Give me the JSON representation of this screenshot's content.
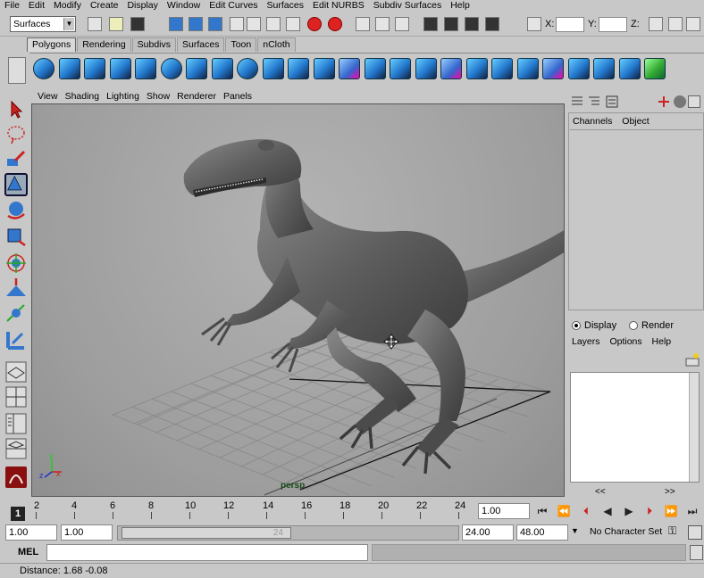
{
  "menubar": [
    "File",
    "Edit",
    "Modify",
    "Create",
    "Display",
    "Window",
    "Edit Curves",
    "Surfaces",
    "Edit NURBS",
    "Subdiv Surfaces",
    "Help"
  ],
  "status": {
    "mode": "Surfaces",
    "x_label": "X:",
    "y_label": "Y:",
    "z_label": "Z:"
  },
  "shelf": {
    "tabs": [
      "Polygons",
      "Rendering",
      "Subdivs",
      "Surfaces",
      "Toon",
      "nCloth"
    ],
    "active": "Polygons"
  },
  "viewport": {
    "menu": [
      "View",
      "Shading",
      "Lighting",
      "Show",
      "Renderer",
      "Panels"
    ],
    "camera": "persp",
    "axis_y": "y",
    "axis_z": "z",
    "axis_x": "x"
  },
  "channel_box": {
    "menu": [
      "Channels",
      "Object"
    ]
  },
  "layer_editor": {
    "display_label": "Display",
    "render_label": "Render",
    "menu": [
      "Layers",
      "Options",
      "Help"
    ],
    "scroll_left": "<<",
    "scroll_right": ">>"
  },
  "timeline": {
    "ticks": [
      "2",
      "4",
      "6",
      "8",
      "10",
      "12",
      "14",
      "16",
      "18",
      "20",
      "22",
      "24"
    ],
    "current_frame": "1",
    "current_time": "1.00",
    "start_time": "1.00",
    "range_start": "1.00",
    "range_end": "24.00",
    "end_time": "48.00",
    "range_thumb_label": "24",
    "character_set": "No Character Set"
  },
  "command_line": {
    "label": "MEL"
  },
  "help_line": {
    "text": "Distance:  1.68     -0.08"
  }
}
